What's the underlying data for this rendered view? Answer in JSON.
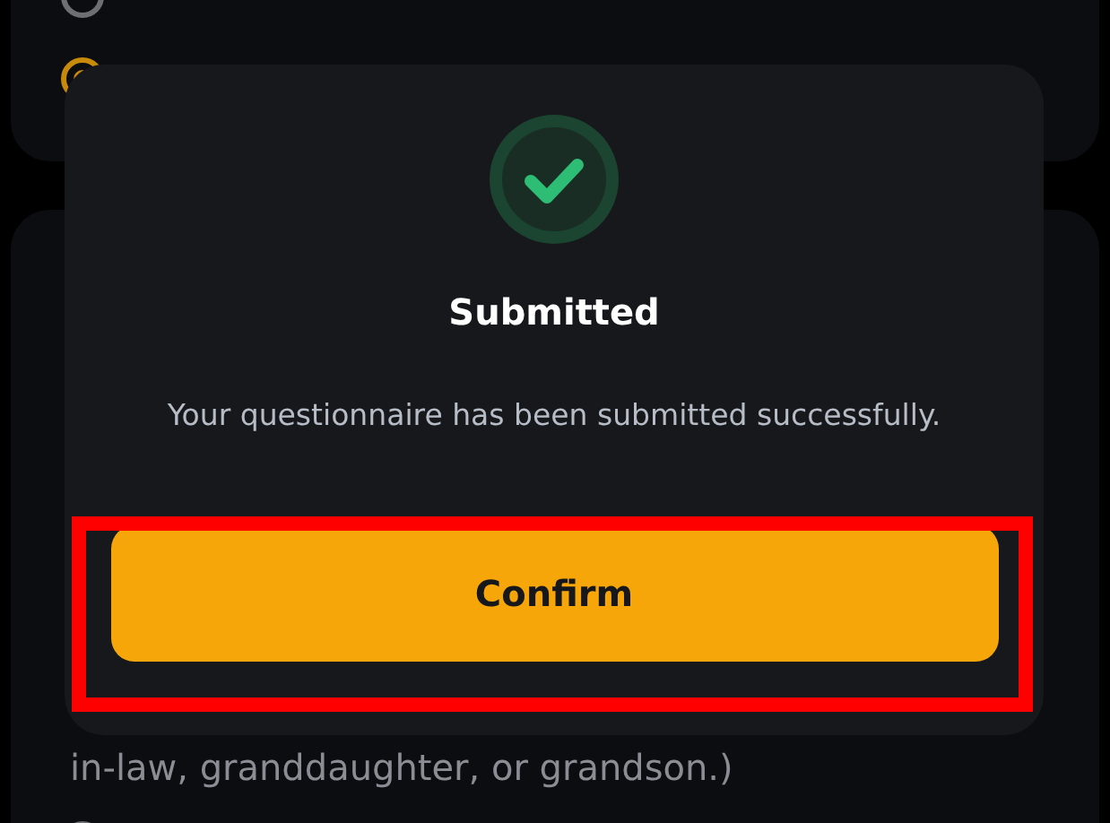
{
  "previous_question": {
    "options": [
      {
        "selected": false
      },
      {
        "selected": true
      }
    ]
  },
  "question": {
    "lines": [
      "in-law, granddaughter, or grandson.)"
    ],
    "options": [
      {
        "selected": false
      }
    ]
  },
  "dialog": {
    "title": "Submitted",
    "message": "Your questionnaire has been submitted successfully.",
    "button": "Confirm",
    "annotation": {
      "kind": "highlight"
    }
  }
}
